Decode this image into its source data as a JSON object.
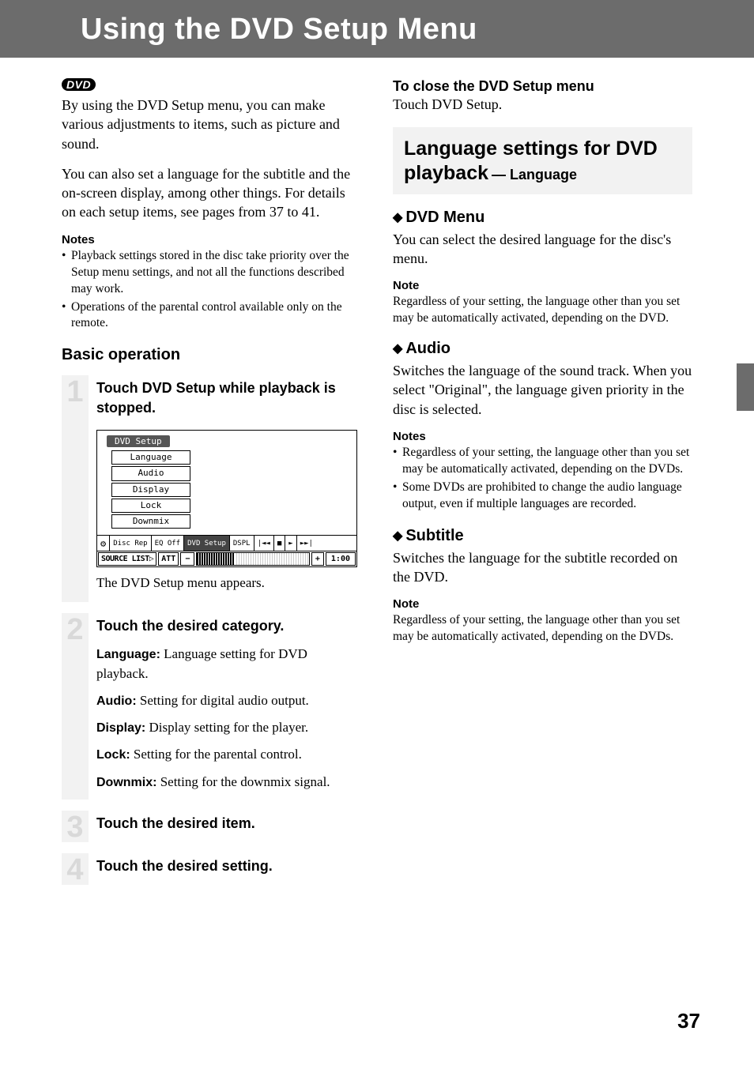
{
  "banner": {
    "title": "Using the DVD Setup Menu"
  },
  "left": {
    "dvd_badge": "DVD",
    "intro_p1": "By using the DVD Setup menu, you can make various adjustments to items, such as picture and sound.",
    "intro_p2": "You can also set a language for the subtitle and the on-screen display, among other things. For details on each setup items, see pages from 37 to 41.",
    "notes_heading": "Notes",
    "notes": [
      "Playback settings stored in the disc take priority over the Setup menu settings, and not all the functions described may work.",
      "Operations of the parental control available only on the remote."
    ],
    "basic_operation": "Basic operation",
    "steps": [
      {
        "num": "1",
        "title": "Touch DVD Setup while playback is stopped."
      },
      {
        "num": "2",
        "title": "Touch the desired category."
      },
      {
        "num": "3",
        "title": "Touch the desired item."
      },
      {
        "num": "4",
        "title": "Touch the desired setting."
      }
    ],
    "diagram": {
      "title": "DVD Setup",
      "items": [
        "Language",
        "Audio",
        "Display",
        "Lock",
        "Downmix"
      ],
      "toolbar": [
        "Disc Rep",
        "EQ Off",
        "DVD Setup",
        "DSPL",
        "|◄◄",
        "■",
        "►",
        "►►|"
      ],
      "highlight_index": 2,
      "bottom": {
        "source": "SOURCE LIST▷",
        "att": "ATT",
        "minus": "−",
        "plus": "+",
        "time": "1:00"
      }
    },
    "caption1": "The DVD Setup menu appears.",
    "categories": [
      {
        "label": "Language:",
        "desc": " Language setting for DVD playback."
      },
      {
        "label": "Audio:",
        "desc": " Setting for digital audio output."
      },
      {
        "label": "Display:",
        "desc": " Display setting for the player."
      },
      {
        "label": "Lock:",
        "desc": " Setting for the parental control."
      },
      {
        "label": "Downmix:",
        "desc": " Setting for the downmix signal."
      }
    ]
  },
  "right": {
    "close_title": "To close the DVD Setup menu",
    "close_body": "Touch DVD Setup.",
    "section_title": "Language settings for DVD playback",
    "section_suffix": " — Language",
    "blocks": [
      {
        "heading": "DVD Menu",
        "body": "You can select the desired language for the disc's menu.",
        "note_label": "Note",
        "note_type": "single",
        "note": "Regardless of your setting, the language other than you set may be automatically activated, depending on the DVD."
      },
      {
        "heading": "Audio",
        "body": "Switches the language of the sound track. When you select \"Original\", the language given priority in the disc is selected.",
        "note_label": "Notes",
        "note_type": "list",
        "notes": [
          "Regardless of your setting, the language other than you set may be automatically activated, depending on the DVDs.",
          "Some DVDs are prohibited to change the audio language output, even if multiple languages are recorded."
        ]
      },
      {
        "heading": "Subtitle",
        "body": "Switches the language for the subtitle recorded on the DVD.",
        "note_label": "Note",
        "note_type": "single",
        "note": "Regardless of your setting, the language other than you set may be automatically activated, depending on the DVDs."
      }
    ]
  },
  "page_number": "37"
}
